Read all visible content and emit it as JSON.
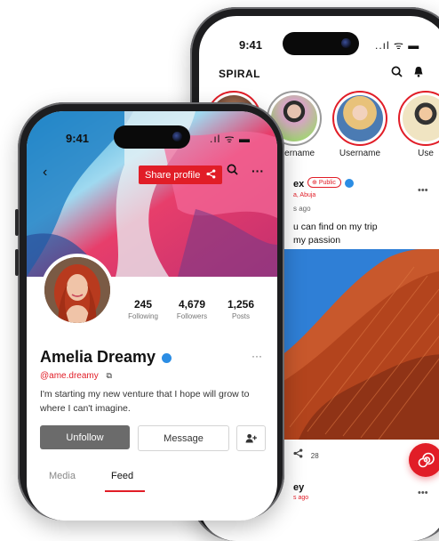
{
  "back_phone": {
    "time": "9:41",
    "status_icons": "..ıl ᯤ ▬",
    "brand": "SPIRAL",
    "header_icons": {
      "search": "search-icon",
      "notifications": "bell-icon"
    },
    "stories": [
      {
        "label": ""
      },
      {
        "label": "Username"
      },
      {
        "label": "Username"
      },
      {
        "label": "Use"
      }
    ],
    "post": {
      "name": "ex",
      "visibility": "Public",
      "location": "a, Abuja",
      "ago": "s ago",
      "caption_line1": "u can find on my trip",
      "caption_line2": "my passion",
      "share_count": "28",
      "next_name": "ey",
      "next_ago": "s ago"
    }
  },
  "front_phone": {
    "time": "9:41",
    "status_icons": ".ıl ᯤ ▬",
    "back_label": "‹",
    "share_label": "Share profile",
    "profile": {
      "name": "Amelia Dreamy",
      "handle": "@ame.dreamy",
      "bio": "I'm starting my new venture that I hope will grow to where I can't imagine.",
      "stats": [
        {
          "value": "245",
          "label": "Following"
        },
        {
          "value": "4,679",
          "label": "Followers"
        },
        {
          "value": "1,256",
          "label": "Posts"
        }
      ]
    },
    "buttons": {
      "unfollow": "Unfollow",
      "message": "Message"
    },
    "tabs": [
      {
        "label": "Media"
      },
      {
        "label": "Feed"
      }
    ],
    "active_tab": "Feed"
  },
  "colors": {
    "accent": "#e11d27",
    "verified": "#2b8de4",
    "unfollow_bg": "#6b6b6b"
  }
}
